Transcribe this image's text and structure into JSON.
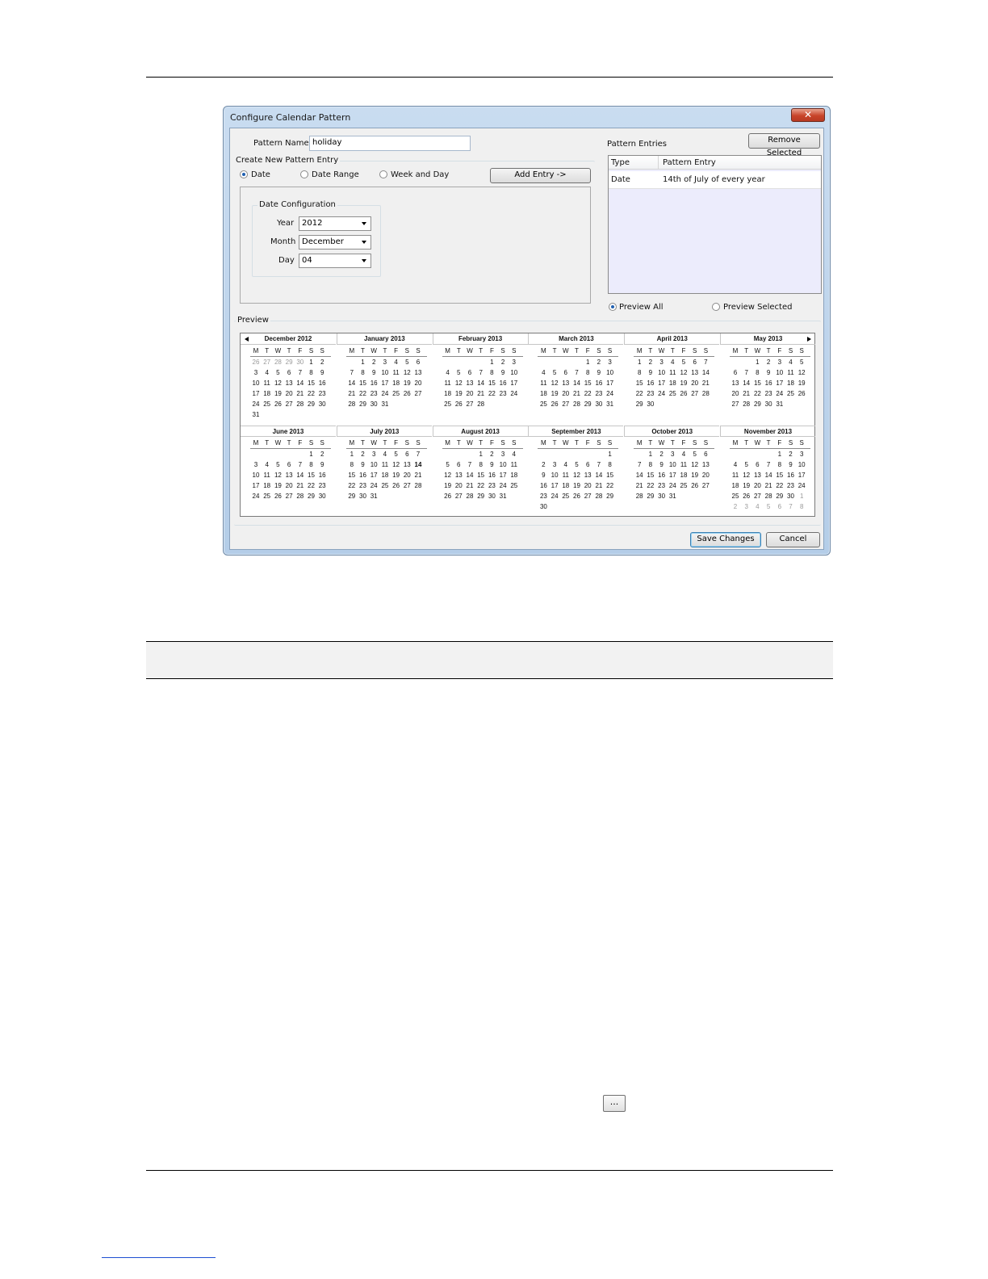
{
  "dialog": {
    "title": "Configure Calendar Pattern",
    "close_label": "✕",
    "pattern_name_label": "Pattern Name",
    "pattern_name_value": "holiday",
    "create_group_label": "Create New Pattern Entry",
    "radio_date": "Date",
    "radio_date_range": "Date Range",
    "radio_week_and_day": "Week and Day",
    "add_entry_label": "Add Entry ->",
    "date_config_label": "Date Configuration",
    "year_label": "Year",
    "year_value": "2012",
    "month_label": "Month",
    "month_value": "December",
    "day_label": "Day",
    "day_value": "04",
    "pattern_entries_label": "Pattern Entries",
    "remove_selected_label": "Remove Selected",
    "entries_columns": [
      "Type",
      "Pattern Entry"
    ],
    "entries_rows": [
      [
        "Date",
        "14th of July of every year"
      ]
    ],
    "preview_all_label": "Preview All",
    "preview_selected_label": "Preview Selected",
    "preview_label": "Preview",
    "save_label": "Save Changes",
    "cancel_label": "Cancel"
  },
  "calendar": {
    "dow": [
      "M",
      "T",
      "W",
      "T",
      "F",
      "S",
      "S"
    ],
    "months": [
      {
        "title": "December 2012",
        "weeks": [
          [
            "26",
            "27",
            "28",
            "29",
            "30",
            "1",
            "2"
          ],
          [
            "3",
            "4",
            "5",
            "6",
            "7",
            "8",
            "9"
          ],
          [
            "10",
            "11",
            "12",
            "13",
            "14",
            "15",
            "16"
          ],
          [
            "17",
            "18",
            "19",
            "20",
            "21",
            "22",
            "23"
          ],
          [
            "24",
            "25",
            "26",
            "27",
            "28",
            "29",
            "30"
          ],
          [
            "31"
          ]
        ],
        "lead_other": 5,
        "trail_from": null
      },
      {
        "title": "January 2013",
        "weeks": [
          [
            "",
            "1",
            "2",
            "3",
            "4",
            "5",
            "6"
          ],
          [
            "7",
            "8",
            "9",
            "10",
            "11",
            "12",
            "13"
          ],
          [
            "14",
            "15",
            "16",
            "17",
            "18",
            "19",
            "20"
          ],
          [
            "21",
            "22",
            "23",
            "24",
            "25",
            "26",
            "27"
          ],
          [
            "28",
            "29",
            "30",
            "31"
          ]
        ],
        "lead_other": 0,
        "trail_from": null
      },
      {
        "title": "February 2013",
        "weeks": [
          [
            "",
            "",
            "",
            "",
            "1",
            "2",
            "3"
          ],
          [
            "4",
            "5",
            "6",
            "7",
            "8",
            "9",
            "10"
          ],
          [
            "11",
            "12",
            "13",
            "14",
            "15",
            "16",
            "17"
          ],
          [
            "18",
            "19",
            "20",
            "21",
            "22",
            "23",
            "24"
          ],
          [
            "25",
            "26",
            "27",
            "28"
          ]
        ],
        "lead_other": 0,
        "trail_from": null
      },
      {
        "title": "March 2013",
        "weeks": [
          [
            "",
            "",
            "",
            "",
            "1",
            "2",
            "3"
          ],
          [
            "4",
            "5",
            "6",
            "7",
            "8",
            "9",
            "10"
          ],
          [
            "11",
            "12",
            "13",
            "14",
            "15",
            "16",
            "17"
          ],
          [
            "18",
            "19",
            "20",
            "21",
            "22",
            "23",
            "24"
          ],
          [
            "25",
            "26",
            "27",
            "28",
            "29",
            "30",
            "31"
          ]
        ],
        "lead_other": 0,
        "trail_from": null
      },
      {
        "title": "April 2013",
        "weeks": [
          [
            "1",
            "2",
            "3",
            "4",
            "5",
            "6",
            "7"
          ],
          [
            "8",
            "9",
            "10",
            "11",
            "12",
            "13",
            "14"
          ],
          [
            "15",
            "16",
            "17",
            "18",
            "19",
            "20",
            "21"
          ],
          [
            "22",
            "23",
            "24",
            "25",
            "26",
            "27",
            "28"
          ],
          [
            "29",
            "30"
          ]
        ],
        "lead_other": 0,
        "trail_from": null
      },
      {
        "title": "May 2013",
        "weeks": [
          [
            "",
            "",
            "1",
            "2",
            "3",
            "4",
            "5"
          ],
          [
            "6",
            "7",
            "8",
            "9",
            "10",
            "11",
            "12"
          ],
          [
            "13",
            "14",
            "15",
            "16",
            "17",
            "18",
            "19"
          ],
          [
            "20",
            "21",
            "22",
            "23",
            "24",
            "25",
            "26"
          ],
          [
            "27",
            "28",
            "29",
            "30",
            "31"
          ]
        ],
        "lead_other": 0,
        "trail_from": null
      },
      {
        "title": "June 2013",
        "weeks": [
          [
            "",
            "",
            "",
            "",
            "",
            "1",
            "2"
          ],
          [
            "3",
            "4",
            "5",
            "6",
            "7",
            "8",
            "9"
          ],
          [
            "10",
            "11",
            "12",
            "13",
            "14",
            "15",
            "16"
          ],
          [
            "17",
            "18",
            "19",
            "20",
            "21",
            "22",
            "23"
          ],
          [
            "24",
            "25",
            "26",
            "27",
            "28",
            "29",
            "30"
          ]
        ],
        "lead_other": 0,
        "trail_from": null
      },
      {
        "title": "July 2013",
        "weeks": [
          [
            "1",
            "2",
            "3",
            "4",
            "5",
            "6",
            "7"
          ],
          [
            "8",
            "9",
            "10",
            "11",
            "12",
            "13",
            "14"
          ],
          [
            "15",
            "16",
            "17",
            "18",
            "19",
            "20",
            "21"
          ],
          [
            "22",
            "23",
            "24",
            "25",
            "26",
            "27",
            "28"
          ],
          [
            "29",
            "30",
            "31"
          ]
        ],
        "lead_other": 0,
        "trail_from": null,
        "highlight": "14"
      },
      {
        "title": "August 2013",
        "weeks": [
          [
            "",
            "",
            "",
            "1",
            "2",
            "3",
            "4"
          ],
          [
            "5",
            "6",
            "7",
            "8",
            "9",
            "10",
            "11"
          ],
          [
            "12",
            "13",
            "14",
            "15",
            "16",
            "17",
            "18"
          ],
          [
            "19",
            "20",
            "21",
            "22",
            "23",
            "24",
            "25"
          ],
          [
            "26",
            "27",
            "28",
            "29",
            "30",
            "31"
          ]
        ],
        "lead_other": 0,
        "trail_from": null
      },
      {
        "title": "September 2013",
        "weeks": [
          [
            "",
            "",
            "",
            "",
            "",
            "",
            "1"
          ],
          [
            "2",
            "3",
            "4",
            "5",
            "6",
            "7",
            "8"
          ],
          [
            "9",
            "10",
            "11",
            "12",
            "13",
            "14",
            "15"
          ],
          [
            "16",
            "17",
            "18",
            "19",
            "20",
            "21",
            "22"
          ],
          [
            "23",
            "24",
            "25",
            "26",
            "27",
            "28",
            "29"
          ],
          [
            "30"
          ]
        ],
        "lead_other": 0,
        "trail_from": null
      },
      {
        "title": "October 2013",
        "weeks": [
          [
            "",
            "1",
            "2",
            "3",
            "4",
            "5",
            "6"
          ],
          [
            "7",
            "8",
            "9",
            "10",
            "11",
            "12",
            "13"
          ],
          [
            "14",
            "15",
            "16",
            "17",
            "18",
            "19",
            "20"
          ],
          [
            "21",
            "22",
            "23",
            "24",
            "25",
            "26",
            "27"
          ],
          [
            "28",
            "29",
            "30",
            "31"
          ]
        ],
        "lead_other": 0,
        "trail_from": null
      },
      {
        "title": "November 2013",
        "weeks": [
          [
            "",
            "",
            "",
            "",
            "1",
            "2",
            "3"
          ],
          [
            "4",
            "5",
            "6",
            "7",
            "8",
            "9",
            "10"
          ],
          [
            "11",
            "12",
            "13",
            "14",
            "15",
            "16",
            "17"
          ],
          [
            "18",
            "19",
            "20",
            "21",
            "22",
            "23",
            "24"
          ],
          [
            "25",
            "26",
            "27",
            "28",
            "29",
            "30",
            "1"
          ],
          [
            "2",
            "3",
            "4",
            "5",
            "6",
            "7",
            "8"
          ]
        ],
        "lead_other": 0,
        "trail_from": [
          4,
          6
        ]
      }
    ]
  },
  "page": {
    "ellipsis_label": "..."
  },
  "colors": {
    "accent": "#1f5fb0",
    "list_background": "#ececfc"
  }
}
